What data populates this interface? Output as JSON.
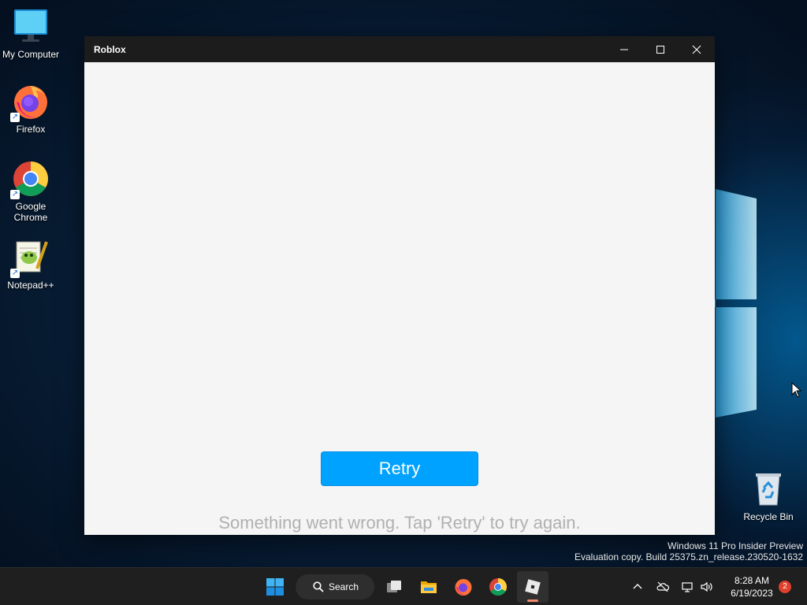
{
  "desktop": {
    "icons": [
      {
        "label": "My Computer",
        "icon": "monitor-icon"
      },
      {
        "label": "Firefox",
        "icon": "firefox-icon"
      },
      {
        "label": "Google\nChrome",
        "icon": "chrome-icon"
      },
      {
        "label": "Notepad++",
        "icon": "notepadpp-icon"
      },
      {
        "label": "Recycle Bin",
        "icon": "recycle-bin-icon"
      }
    ],
    "shortcut_glyph": "↗"
  },
  "window": {
    "title": "Roblox",
    "retry_label": "Retry",
    "error_message": "Something went wrong. Tap 'Retry' to try again.",
    "accent_color": "#00a2ff"
  },
  "watermark": {
    "line1": "Windows 11 Pro Insider Preview",
    "line2": "Evaluation copy. Build 25375.zn_release.230520-1632"
  },
  "taskbar": {
    "search_label": "Search",
    "apps": [
      "start-icon",
      "task-view-icon",
      "file-explorer-icon",
      "firefox-icon",
      "chrome-icon",
      "roblox-icon"
    ],
    "active_app": "roblox-icon"
  },
  "tray": {
    "time": "8:28 AM",
    "date": "6/19/2023",
    "notification_count": "2"
  }
}
